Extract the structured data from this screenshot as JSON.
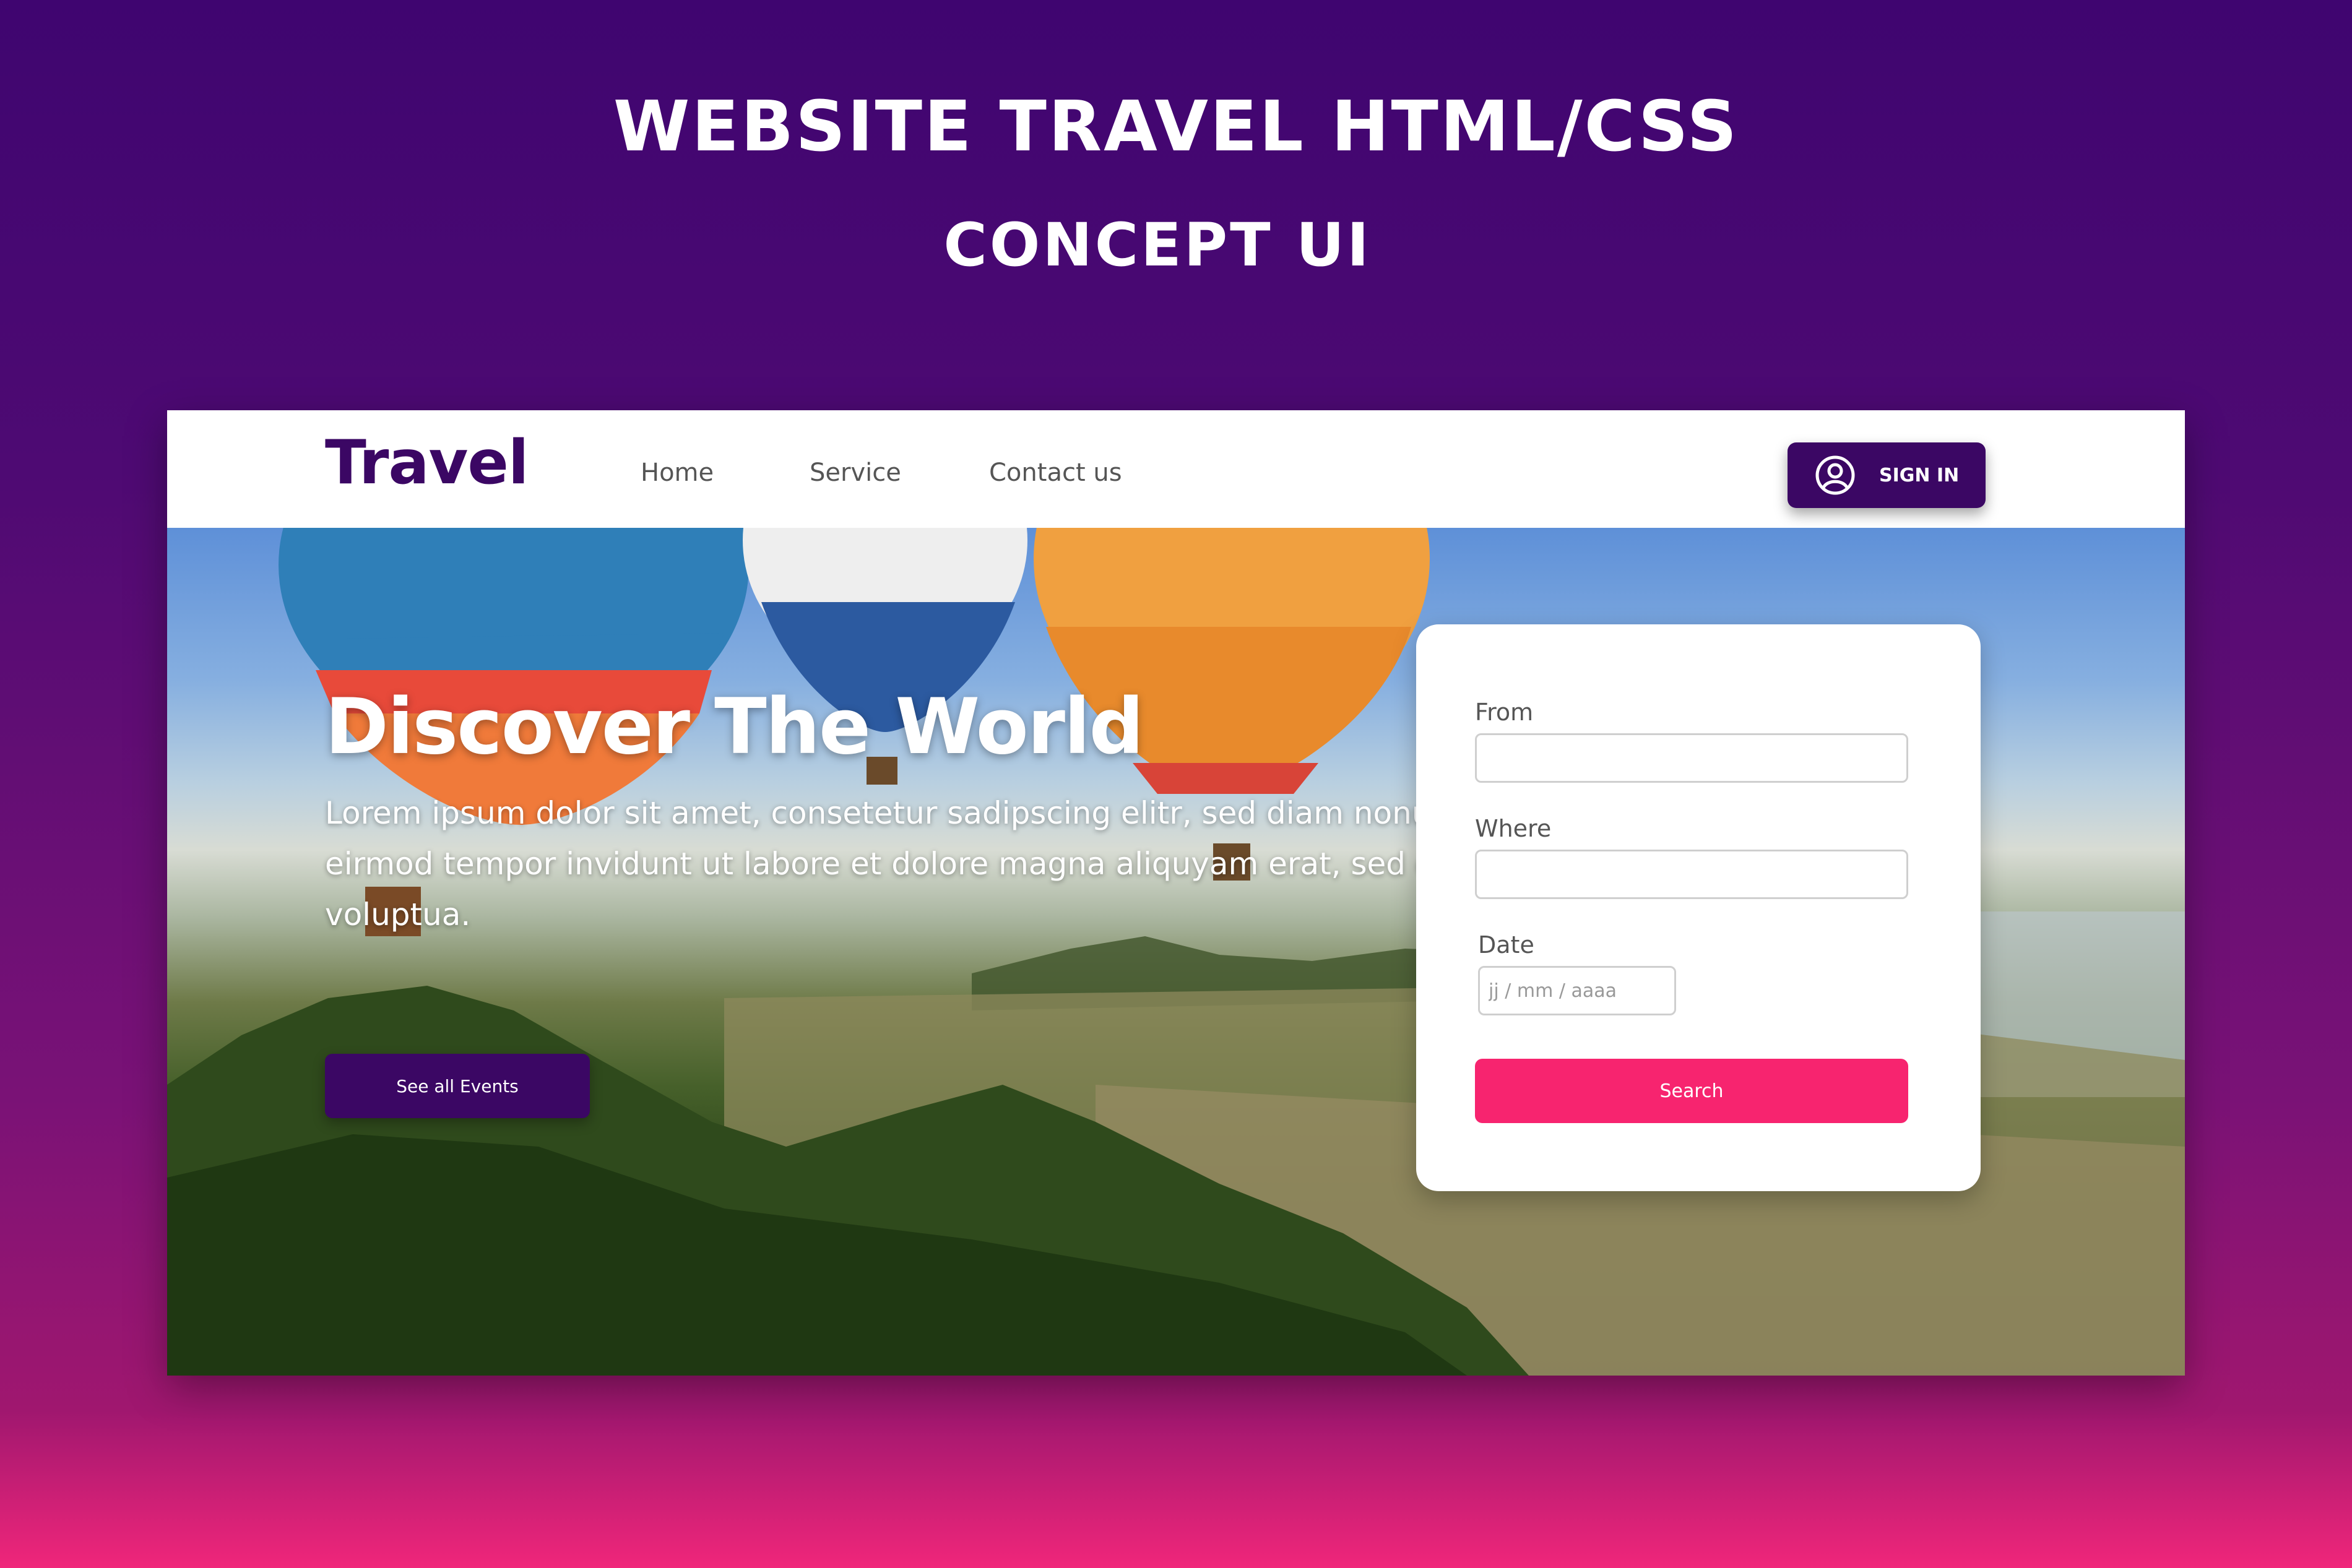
{
  "promo": {
    "title": "WEBSITE TRAVEL  HTML/CSS",
    "subtitle": "CONCEPT UI"
  },
  "navbar": {
    "logo": "Travel",
    "links": [
      "Home",
      "Service",
      "Contact us"
    ],
    "signin_label": "SIGN IN",
    "signin_icon": "user-circle-icon"
  },
  "hero": {
    "title": "Discover The World",
    "text": "Lorem ipsum dolor sit amet, consetetur sadipscing elitr, sed diam nonumy eirmod tempor invidunt ut labore et dolore magna aliquyam erat, sed diam voluptua.",
    "button_label": "See all Events"
  },
  "search_form": {
    "from_label": "From",
    "from_value": "",
    "where_label": "Where",
    "where_value": "",
    "date_label": "Date",
    "date_placeholder": "jj / mm / aaaa",
    "search_label": "Search"
  },
  "colors": {
    "brand_purple": "#3b0764",
    "accent_pink": "#f7246f",
    "background_top": "#3f0570",
    "background_bottom": "#f0267a"
  }
}
